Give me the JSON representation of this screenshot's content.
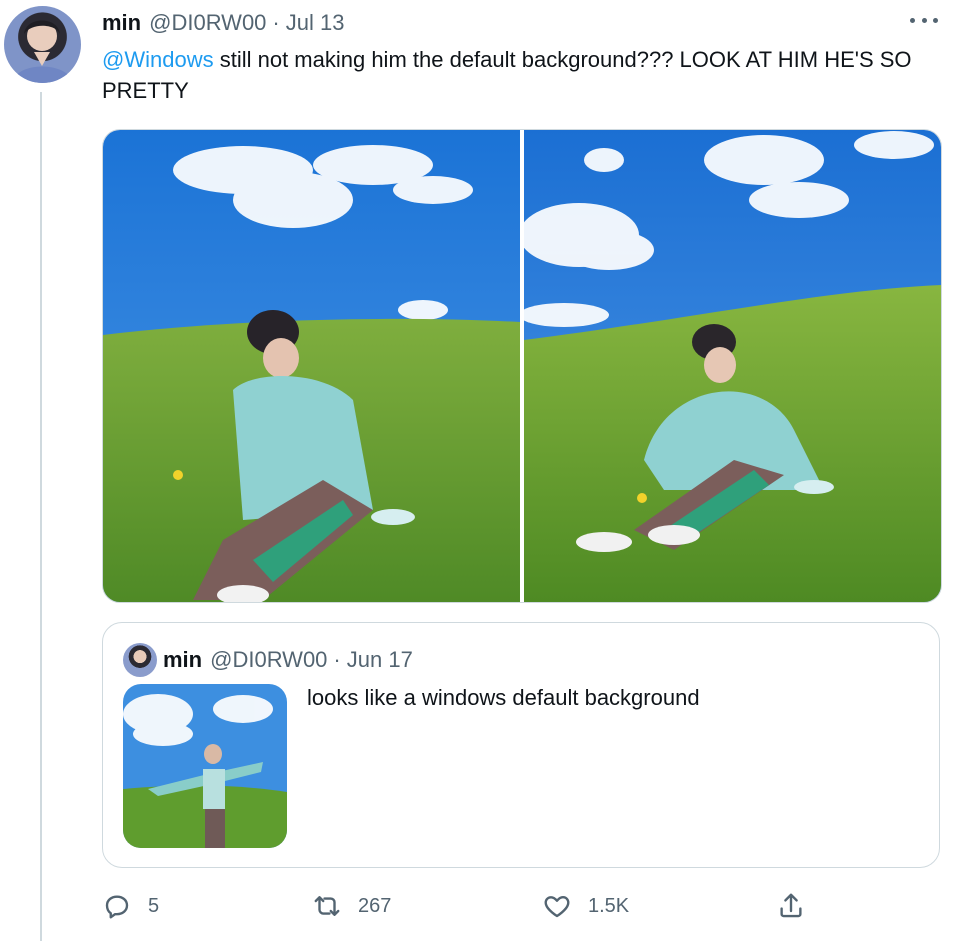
{
  "tweet": {
    "author_name": "min",
    "author_handle": "@DI0RW00",
    "date": "Jul 13",
    "mention": "@Windows",
    "text": " still not making him the default background??? LOOK AT HIM HE'S SO PRETTY",
    "images": [
      "photo-grass-sitting-1",
      "photo-grass-sitting-2"
    ]
  },
  "quoted": {
    "author_name": "min",
    "author_handle": "@DI0RW00",
    "date": "Jun 17",
    "text": "looks like a windows default background"
  },
  "actions": {
    "replies": "5",
    "retweets": "267",
    "likes": "1.5K"
  },
  "icons": {
    "more": "more-horizontal-icon",
    "reply": "reply-icon",
    "retweet": "retweet-icon",
    "like": "heart-icon",
    "share": "share-icon"
  },
  "colors": {
    "accent": "#1d9bf0",
    "secondary_text": "#536471",
    "border": "#cfd9de"
  }
}
